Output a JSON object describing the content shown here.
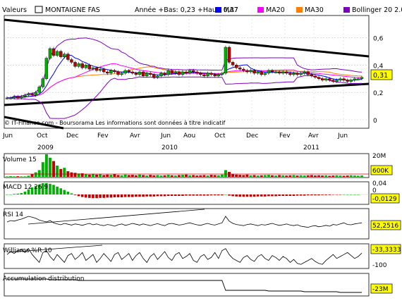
{
  "colors": {
    "up": "#00b000",
    "down": "#c00000",
    "ma7": "#0000ff",
    "ma20": "#ff00ff",
    "ma30": "#ff8000",
    "bollinger": "#8000c0",
    "grid": "#c8c8c8",
    "value_box": "#ffff00"
  },
  "header": {
    "valeurs_label": "Valeurs",
    "name": "MONTAIGNE FAS",
    "range": "Année +Bas: 0,23 +Haut: 0,37",
    "legend": [
      {
        "label": "MA7",
        "color": "#0000ff"
      },
      {
        "label": "MA20",
        "color": "#ff00ff"
      },
      {
        "label": "MA30",
        "color": "#ff8000"
      },
      {
        "label": "Bollinger 20 2.0",
        "color": "#8000c0"
      }
    ]
  },
  "price_panel": {
    "y_ticks": [
      "0,6",
      "0,4",
      "0,2",
      "0"
    ],
    "current_value": "0,31",
    "watermark": "© IT-Finance.com - Boursorama Les informations sont données à titre indicatif",
    "x_labels": [
      "Jun",
      "Oct",
      "Dec",
      "Fev",
      "Avr",
      "Jun",
      "Aou",
      "Oct",
      "Dec",
      "Fev",
      "Avr",
      "Jun"
    ],
    "years": [
      "2009",
      "2010",
      "2011"
    ]
  },
  "volume_panel": {
    "label": "Volume 15",
    "ticks": [
      "20M",
      "600K"
    ]
  },
  "macd_panel": {
    "label": "MACD 12 26 9",
    "ticks": [
      "0,04",
      "0",
      "-0,0129"
    ]
  },
  "rsi_panel": {
    "label": "RSI 14",
    "value": "52,2516"
  },
  "williams_panel": {
    "label": "Williams %R 10",
    "ticks": [
      "-33,3333",
      "-100"
    ]
  },
  "accum_panel": {
    "label": "Accumulation distribution",
    "value": "-23M"
  },
  "chart_data": {
    "type": "candlestick",
    "title": "MONTAIGNE FAS",
    "ylim": [
      0,
      0.7
    ],
    "price_series": [
      0.16,
      0.16,
      0.17,
      0.16,
      0.17,
      0.18,
      0.19,
      0.18,
      0.2,
      0.24,
      0.3,
      0.45,
      0.52,
      0.47,
      0.5,
      0.46,
      0.48,
      0.44,
      0.42,
      0.39,
      0.41,
      0.38,
      0.4,
      0.37,
      0.38,
      0.36,
      0.37,
      0.35,
      0.34,
      0.36,
      0.35,
      0.33,
      0.34,
      0.36,
      0.35,
      0.34,
      0.33,
      0.35,
      0.32,
      0.34,
      0.33,
      0.31,
      0.32,
      0.34,
      0.33,
      0.36,
      0.34,
      0.35,
      0.33,
      0.35,
      0.34,
      0.36,
      0.35,
      0.34,
      0.33,
      0.32,
      0.34,
      0.33,
      0.32,
      0.33,
      0.34,
      0.53,
      0.42,
      0.4,
      0.38,
      0.37,
      0.36,
      0.35,
      0.36,
      0.34,
      0.35,
      0.33,
      0.34,
      0.36,
      0.35,
      0.35,
      0.34,
      0.35,
      0.34,
      0.33,
      0.34,
      0.33,
      0.34,
      0.35,
      0.33,
      0.32,
      0.31,
      0.3,
      0.29,
      0.3,
      0.29,
      0.28,
      0.29,
      0.3,
      0.29,
      0.28,
      0.29,
      0.3,
      0.3,
      0.31
    ],
    "volume_series": [
      0.02,
      0.03,
      0.02,
      0.03,
      0.02,
      0.02,
      0.05,
      0.12,
      0.2,
      0.3,
      0.65,
      1.0,
      0.85,
      0.7,
      0.5,
      0.35,
      0.4,
      0.25,
      0.2,
      0.18,
      0.15,
      0.16,
      0.12,
      0.1,
      0.14,
      0.1,
      0.12,
      0.08,
      0.1,
      0.09,
      0.12,
      0.08,
      0.07,
      0.1,
      0.08,
      0.09,
      0.07,
      0.1,
      0.08,
      0.06,
      0.09,
      0.07,
      0.08,
      0.06,
      0.07,
      0.09,
      0.07,
      0.06,
      0.08,
      0.09,
      0.1,
      0.07,
      0.08,
      0.06,
      0.07,
      0.08,
      0.06,
      0.09,
      0.08,
      0.07,
      0.1,
      0.3,
      0.22,
      0.12,
      0.1,
      0.09,
      0.08,
      0.1,
      0.07,
      0.08,
      0.06,
      0.07,
      0.08,
      0.09,
      0.07,
      0.06,
      0.08,
      0.07,
      0.06,
      0.07,
      0.08,
      0.06,
      0.07,
      0.06,
      0.07,
      0.08,
      0.06,
      0.07,
      0.06,
      0.07,
      0.05,
      0.06,
      0.07,
      0.06,
      0.05,
      0.06,
      0.07,
      0.06,
      0.05,
      0.06
    ],
    "macd_series": [
      0,
      0,
      0.002,
      0.003,
      0.005,
      0.01,
      0.018,
      0.025,
      0.03,
      0.035,
      0.04,
      0.04,
      0.038,
      0.034,
      0.028,
      0.022,
      0.016,
      0.01,
      0.004,
      -0.002,
      -0.006,
      -0.009,
      -0.011,
      -0.012,
      -0.013,
      -0.013,
      -0.012,
      -0.012,
      -0.011,
      -0.011,
      -0.01,
      -0.01,
      -0.01,
      -0.009,
      -0.009,
      -0.009,
      -0.008,
      -0.008,
      -0.008,
      -0.007,
      -0.007,
      -0.007,
      -0.006,
      -0.006,
      -0.006,
      -0.005,
      -0.005,
      -0.005,
      -0.005,
      -0.005,
      -0.004,
      -0.004,
      -0.004,
      -0.004,
      -0.004,
      -0.004,
      -0.004,
      -0.003,
      -0.003,
      -0.003,
      -0.003,
      0,
      -0.004,
      -0.006,
      -0.007,
      -0.008,
      -0.008,
      -0.008,
      -0.008,
      -0.008,
      -0.007,
      -0.007,
      -0.007,
      -0.006,
      -0.006,
      -0.006,
      -0.005,
      -0.005,
      -0.005,
      -0.005,
      -0.005,
      -0.004,
      -0.004,
      -0.004,
      -0.003,
      -0.003,
      -0.003,
      -0.003,
      -0.002,
      -0.002,
      -0.002,
      -0.001,
      -0.001,
      -0.001,
      0,
      0,
      0,
      0,
      0
    ],
    "rsi_series": [
      55,
      60,
      58,
      62,
      65,
      70,
      75,
      72,
      68,
      62,
      58,
      55,
      60,
      52,
      48,
      45,
      50,
      47,
      44,
      48,
      46,
      43,
      47,
      50,
      45,
      48,
      44,
      42,
      46,
      44,
      40,
      45,
      48,
      43,
      46,
      50,
      47,
      44,
      48,
      45,
      42,
      46,
      49,
      45,
      42,
      48,
      50,
      47,
      44,
      46,
      49,
      52,
      48,
      45,
      43,
      47,
      50,
      46,
      44,
      48,
      52,
      75,
      58,
      50,
      46,
      44,
      42,
      46,
      48,
      45,
      42,
      46,
      44,
      47,
      50,
      46,
      43,
      45,
      48,
      44,
      42,
      45,
      40,
      38,
      36,
      40,
      42,
      38,
      40,
      43,
      40,
      46,
      44,
      48,
      52,
      46,
      45,
      48,
      50,
      52
    ],
    "williams_series": [
      -40,
      -25,
      -35,
      -20,
      -15,
      -30,
      -10,
      -40,
      -60,
      -80,
      -30,
      -20,
      -50,
      -70,
      -40,
      -60,
      -80,
      -45,
      -35,
      -65,
      -50,
      -30,
      -70,
      -55,
      -40,
      -80,
      -60,
      -35,
      -55,
      -75,
      -40,
      -30,
      -65,
      -50,
      -35,
      -70,
      -45,
      -30,
      -60,
      -80,
      -50,
      -35,
      -65,
      -45,
      -25,
      -55,
      -70,
      -40,
      -30,
      -60,
      -50,
      -35,
      -70,
      -80,
      -50,
      -40,
      -65,
      -55,
      -30,
      -60,
      -20,
      -10,
      -40,
      -60,
      -70,
      -80,
      -55,
      -45,
      -65,
      -75,
      -50,
      -40,
      -60,
      -70,
      -45,
      -55,
      -70,
      -50,
      -60,
      -80,
      -65,
      -85,
      -90,
      -80,
      -70,
      -60,
      -75,
      -85,
      -90,
      -70,
      -55,
      -40,
      -60,
      -50,
      -40,
      -30,
      -45,
      -60,
      -50,
      -33
    ],
    "accum_series": [
      -4,
      -4,
      -4,
      -4,
      -4,
      -4,
      -4,
      -4,
      -4,
      -4,
      -4,
      -4,
      -5,
      -5,
      -5,
      -5,
      -5,
      -5,
      -5,
      -5,
      -6,
      -6,
      -6,
      -6,
      -6,
      -6,
      -6,
      -6,
      -6,
      -6,
      -6,
      -6,
      -6,
      -6,
      -6,
      -6,
      -6,
      -6,
      -6,
      -6,
      -6,
      -6,
      -6,
      -6,
      -6,
      -6,
      -6,
      -6,
      -6,
      -6,
      -6,
      -6,
      -6,
      -6,
      -6,
      -6,
      -6,
      -6,
      -6,
      -6,
      -6,
      -20,
      -20,
      -20,
      -20,
      -20,
      -20,
      -20,
      -20,
      -20,
      -20,
      -20,
      -20,
      -21,
      -21,
      -21,
      -21,
      -21,
      -21,
      -21,
      -21,
      -21,
      -21,
      -22,
      -22,
      -22,
      -22,
      -22,
      -22,
      -22,
      -22,
      -22,
      -22,
      -23,
      -23,
      -23,
      -23,
      -23,
      -23,
      -23
    ]
  }
}
